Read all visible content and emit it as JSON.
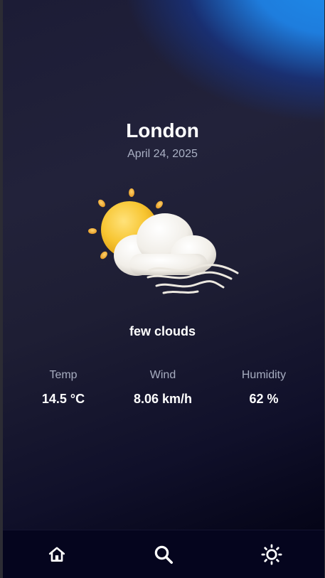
{
  "location": {
    "city": "London",
    "date": "April 24, 2025"
  },
  "weather": {
    "icon": "few-clouds-icon",
    "condition": "few clouds"
  },
  "stats": [
    {
      "label": "Temp",
      "value": "14.5 °C"
    },
    {
      "label": "Wind",
      "value": "8.06 km/h"
    },
    {
      "label": "Humidity",
      "value": "62 %"
    }
  ],
  "nav": {
    "items": [
      {
        "icon": "home-icon"
      },
      {
        "icon": "search-icon"
      },
      {
        "icon": "sun-icon"
      }
    ]
  },
  "colors": {
    "background": "#1e1e34",
    "accent_glow": "#1e8ceb",
    "nav_background": "#05051e",
    "text_primary": "#ffffff",
    "text_secondary": "#a7adc0"
  }
}
